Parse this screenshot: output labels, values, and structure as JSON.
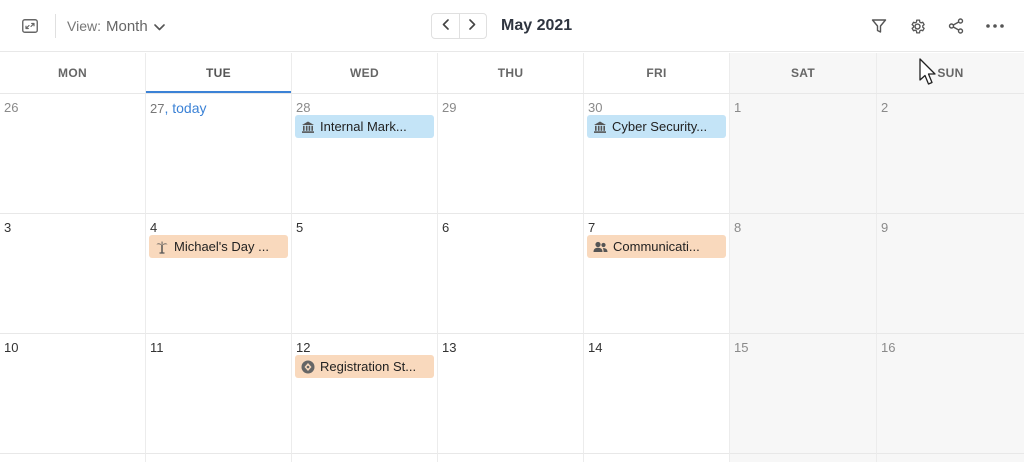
{
  "toolbar": {
    "view_label": "View:",
    "view_value": "Month",
    "month_title": "May 2021"
  },
  "weekdays": [
    "MON",
    "TUE",
    "WED",
    "THU",
    "FRI",
    "SAT",
    "SUN"
  ],
  "today_label": ", today",
  "weeks": [
    {
      "days": [
        {
          "num": "26"
        },
        {
          "num": "27"
        },
        {
          "num": "28",
          "event": {
            "label": "Internal Mark...",
            "icon": "bank-icon",
            "color": "#c4e4f7"
          }
        },
        {
          "num": "29"
        },
        {
          "num": "30",
          "event": {
            "label": "Cyber Security...",
            "icon": "bank-icon",
            "color": "#c4e4f7"
          }
        },
        {
          "num": "1"
        },
        {
          "num": "2"
        }
      ]
    },
    {
      "days": [
        {
          "num": "3"
        },
        {
          "num": "4",
          "event": {
            "label": "Michael's Day ...",
            "icon": "palm-tree-icon",
            "color": "#f9d9bd"
          }
        },
        {
          "num": "5"
        },
        {
          "num": "6"
        },
        {
          "num": "7",
          "event": {
            "label": "Communicati...",
            "icon": "people-icon",
            "color": "#f9d9bd"
          }
        },
        {
          "num": "8"
        },
        {
          "num": "9"
        }
      ]
    },
    {
      "days": [
        {
          "num": "10"
        },
        {
          "num": "11"
        },
        {
          "num": "12",
          "event": {
            "label": "Registration St...",
            "icon": "milestone-icon",
            "color": "#f9d9bd"
          }
        },
        {
          "num": "13"
        },
        {
          "num": "14"
        },
        {
          "num": "15"
        },
        {
          "num": "16"
        }
      ]
    }
  ],
  "colors": {
    "accent": "#3b82d6",
    "event_blue": "#c4e4f7",
    "event_orange": "#f9d9bd",
    "weekend_bg": "#f7f7f7"
  }
}
